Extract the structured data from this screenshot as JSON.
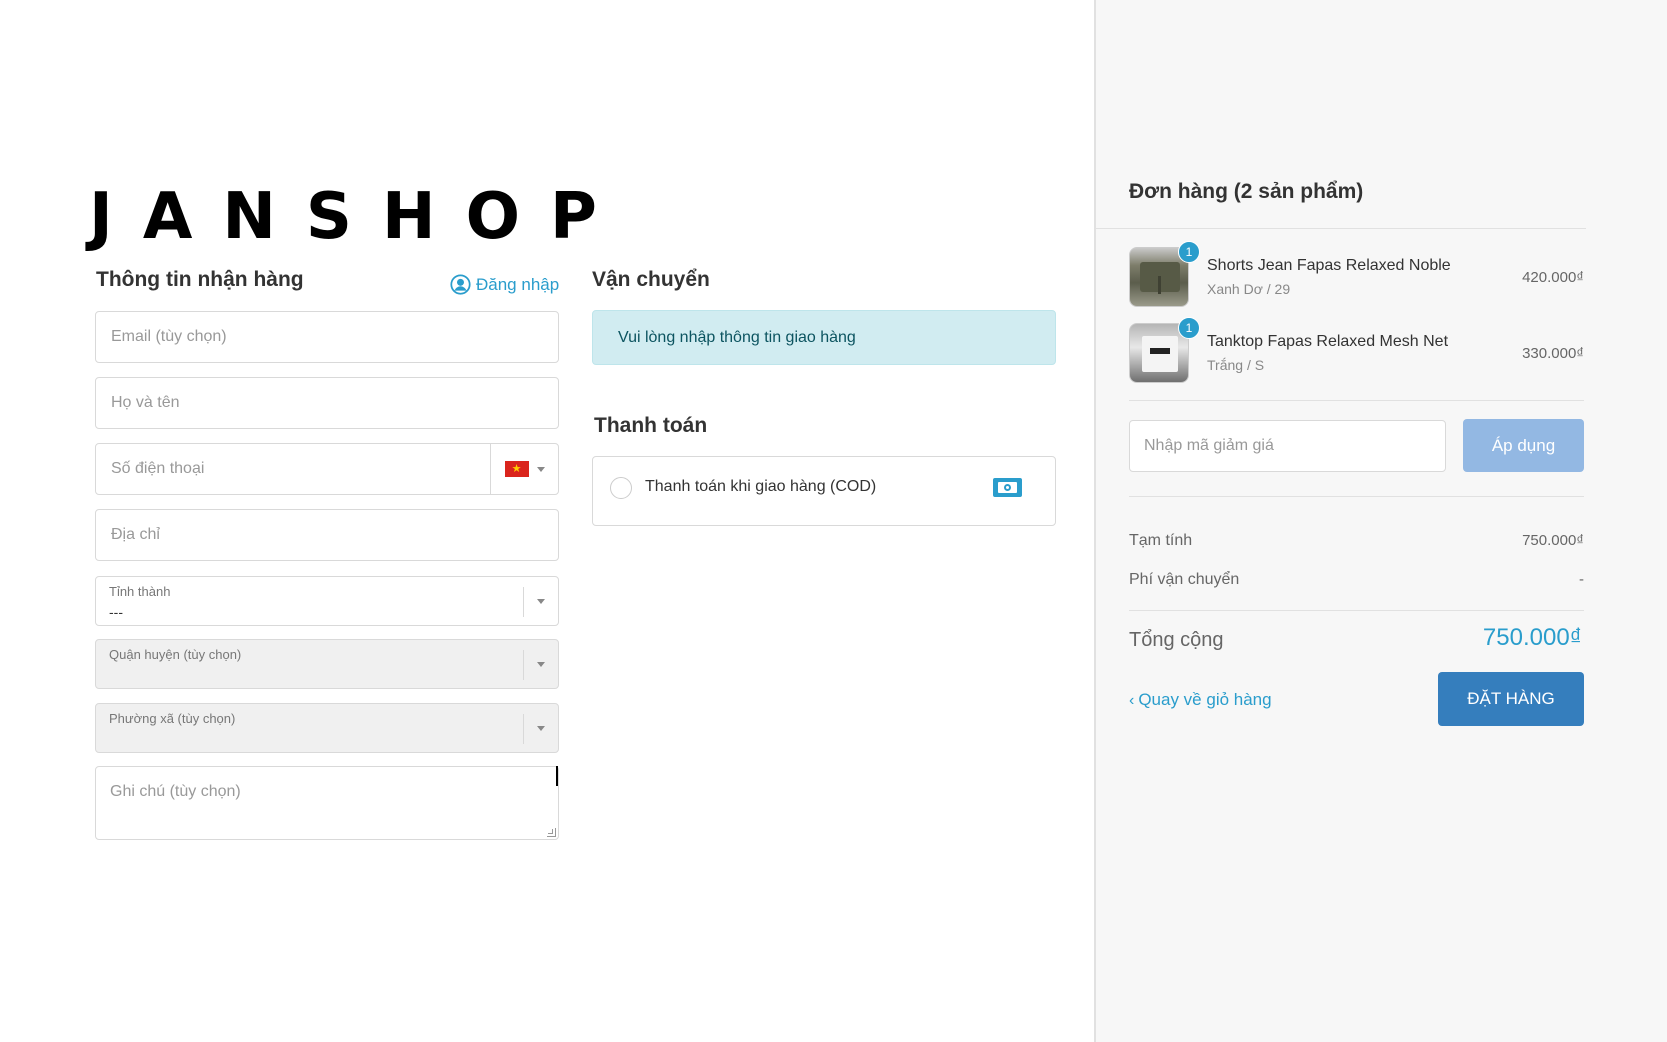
{
  "brand": {
    "logo_text": "JANSHOP"
  },
  "recipient": {
    "title": "Thông tin nhận hàng",
    "login_label": "Đăng nhập",
    "email_placeholder": "Email (tùy chọn)",
    "email_value": "",
    "name_placeholder": "Họ và tên",
    "name_value": "",
    "phone_placeholder": "Số điện thoại",
    "phone_value": "",
    "phone_country": "VN",
    "address_placeholder": "Địa chỉ",
    "address_value": "",
    "province": {
      "label": "Tỉnh thành",
      "value": "---"
    },
    "district": {
      "label": "Quận huyện (tùy chọn)",
      "value": ""
    },
    "ward": {
      "label": "Phường xã (tùy chọn)",
      "value": ""
    },
    "note_placeholder": "Ghi chú (tùy chọn)",
    "note_value": ""
  },
  "shipping": {
    "title": "Vận chuyển",
    "alert": "Vui lòng nhập thông tin giao hàng"
  },
  "payment": {
    "title": "Thanh toán",
    "method_label": "Thanh toán khi giao hàng (COD)",
    "selected": false
  },
  "order": {
    "title": "Đơn hàng (2 sản phẩm)",
    "items": [
      {
        "name": "Shorts Jean Fapas Relaxed Noble",
        "variant": "Xanh Dơ / 29",
        "price": "420.000₫",
        "qty": "1"
      },
      {
        "name": "Tanktop Fapas Relaxed Mesh Net",
        "variant": "Trắng / S",
        "price": "330.000₫",
        "qty": "1"
      }
    ],
    "discount_placeholder": "Nhập mã giảm giá",
    "discount_value": "",
    "apply_label": "Áp dụng",
    "subtotal_label": "Tạm tính",
    "subtotal_value": "750.000₫",
    "shipping_fee_label": "Phí vận chuyển",
    "shipping_fee_value": "-",
    "total_label": "Tổng cộng",
    "total_value": "750.000₫",
    "back_label": "Quay về giỏ hàng",
    "place_order_label": "ĐẶT HÀNG"
  },
  "colors": {
    "accent": "#2a9dcc",
    "primary_button": "#357ebd",
    "apply_button": "#93b8e3",
    "alert_bg": "#d1ecf1",
    "sidebar_bg": "#f7f7f7"
  },
  "icons": {
    "login": "user-circle-icon",
    "flag": "vietnam-flag-icon",
    "payment": "cash-icon",
    "back": "chevron-left-icon"
  }
}
